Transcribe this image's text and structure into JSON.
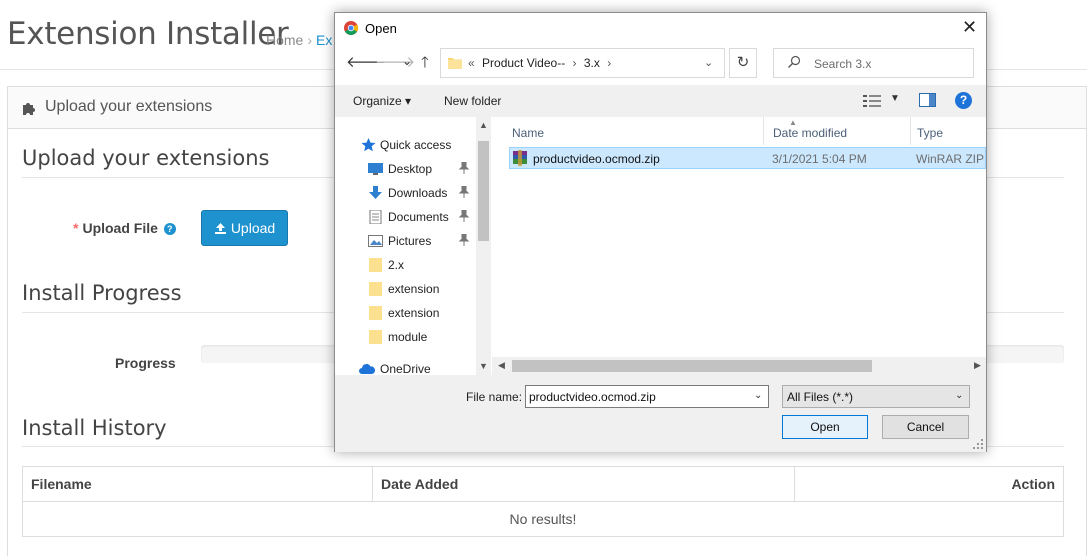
{
  "page": {
    "title": "Extension Installer",
    "breadcrumb": [
      "Home",
      "Ex"
    ],
    "panel_heading": "Upload your extensions",
    "upload_section": {
      "legend": "Upload your extensions",
      "label": "Upload File",
      "required_mark": "*",
      "help": "?",
      "button": "Upload"
    },
    "progress_section": {
      "legend": "Install Progress",
      "label": "Progress",
      "value": 0
    },
    "history_section": {
      "legend": "Install History",
      "columns": [
        "Filename",
        "Date Added",
        "Action"
      ],
      "empty": "No results!"
    },
    "colors": {
      "primary": "#1e91cf",
      "required": "#f56b6b"
    }
  },
  "dialog": {
    "title": "Open",
    "close": "✕",
    "nav": {
      "back": "🡐",
      "forward": "🡒",
      "recent": "⌄",
      "up": "🡑",
      "refresh": "↻"
    },
    "address": {
      "overflow": "«",
      "path": [
        "Product Video--",
        "3.x"
      ],
      "chev": "›"
    },
    "search_placeholder": "Search 3.x",
    "toolbar": {
      "organize": "Organize ▾",
      "new_folder": "New folder",
      "help": "?"
    },
    "nav_pane": [
      {
        "label": "Quick access",
        "icon": "star-icon",
        "pinned": false
      },
      {
        "label": "Desktop",
        "icon": "desktop-icon",
        "pinned": true
      },
      {
        "label": "Downloads",
        "icon": "downloads-icon",
        "pinned": true
      },
      {
        "label": "Documents",
        "icon": "documents-icon",
        "pinned": true
      },
      {
        "label": "Pictures",
        "icon": "pictures-icon",
        "pinned": true
      },
      {
        "label": "2.x",
        "icon": "folder-icon",
        "pinned": false
      },
      {
        "label": "extension",
        "icon": "folder-icon",
        "pinned": false
      },
      {
        "label": "extension",
        "icon": "folder-icon",
        "pinned": false
      },
      {
        "label": "module",
        "icon": "folder-icon",
        "pinned": false
      },
      {
        "label": "OneDrive",
        "icon": "cloud-icon",
        "pinned": false
      }
    ],
    "columns": [
      "Name",
      "Date modified",
      "Type"
    ],
    "files": [
      {
        "name": "productvideo.ocmod.zip",
        "date": "3/1/2021 5:04 PM",
        "type": "WinRAR ZIP a",
        "selected": true
      }
    ],
    "file_name_label": "File name:",
    "file_name_value": "productvideo.ocmod.zip",
    "filter": "All Files (*.*)",
    "open_button": "Open",
    "cancel_button": "Cancel"
  }
}
